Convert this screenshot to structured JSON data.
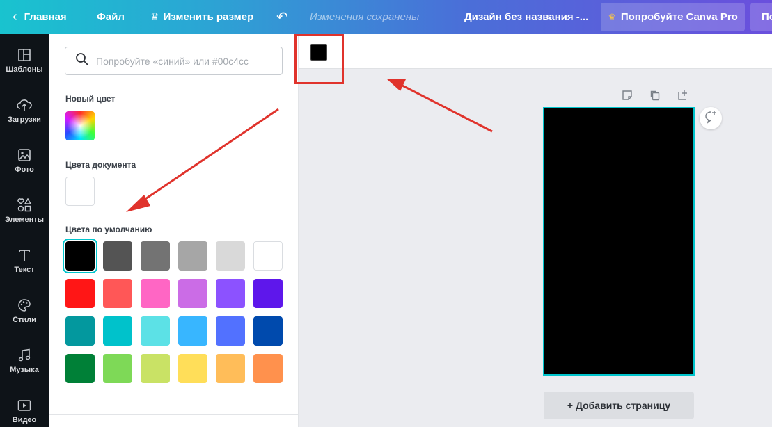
{
  "topbar": {
    "home_label": "Главная",
    "file_label": "Файл",
    "resize_label": "Изменить размер",
    "saved_status": "Изменения сохранены",
    "design_title": "Дизайн без названия -...",
    "pro_label": "Попробуйте Canva Pro",
    "share_label": "Поделиться"
  },
  "sidenav": {
    "items": [
      {
        "label": "Шаблоны",
        "icon": "templates-icon"
      },
      {
        "label": "Загрузки",
        "icon": "upload-icon"
      },
      {
        "label": "Фото",
        "icon": "photo-icon"
      },
      {
        "label": "Элементы",
        "icon": "elements-icon"
      },
      {
        "label": "Текст",
        "icon": "text-icon"
      },
      {
        "label": "Стили",
        "icon": "styles-icon"
      },
      {
        "label": "Музыка",
        "icon": "music-icon"
      },
      {
        "label": "Видео",
        "icon": "video-icon"
      }
    ]
  },
  "panel": {
    "search_placeholder": "Попробуйте «синий» или #00c4cc",
    "new_color_label": "Новый цвет",
    "document_colors_label": "Цвета документа",
    "default_colors_label": "Цвета по умолчанию",
    "document_colors": [
      "#ffffff"
    ],
    "default_colors": [
      "#000000",
      "#545454",
      "#737373",
      "#a6a6a6",
      "#d9d9d9",
      "#ffffff",
      "#ff1616",
      "#ff5757",
      "#ff66c4",
      "#cb6ce6",
      "#8c52ff",
      "#5e17eb",
      "#03989e",
      "#00c2cb",
      "#5ce1e6",
      "#38b6ff",
      "#5271ff",
      "#004aad",
      "#008037",
      "#7ed957",
      "#c9e265",
      "#ffde59",
      "#ffbd59",
      "#ff914d"
    ],
    "selected_color": "#000000"
  },
  "canvas": {
    "fill_color": "#000000",
    "page_color": "#000000",
    "add_page_label": "+ Добавить страницу"
  },
  "colors": {
    "accent": "#00c4cc",
    "annotation": "#e0332c"
  }
}
